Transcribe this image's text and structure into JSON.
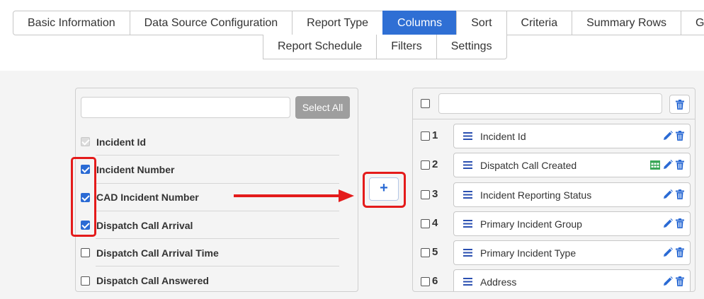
{
  "tabs_row1": [
    {
      "label": "Basic Information",
      "active": false
    },
    {
      "label": "Data Source Configuration",
      "active": false
    },
    {
      "label": "Report Type",
      "active": false
    },
    {
      "label": "Columns",
      "active": true
    },
    {
      "label": "Sort",
      "active": false
    },
    {
      "label": "Criteria",
      "active": false
    },
    {
      "label": "Summary Rows",
      "active": false
    },
    {
      "label": "G",
      "active": false
    }
  ],
  "tabs_row2": [
    {
      "label": "Report Schedule"
    },
    {
      "label": "Filters"
    },
    {
      "label": "Settings"
    }
  ],
  "left_panel": {
    "search_placeholder": "",
    "select_all_label": "Select All",
    "fields": [
      {
        "label": "Incident Id",
        "state": "disabled-checked"
      },
      {
        "label": "Incident Number",
        "state": "checked"
      },
      {
        "label": "CAD Incident Number",
        "state": "checked"
      },
      {
        "label": "Dispatch Call Arrival",
        "state": "checked"
      },
      {
        "label": "Dispatch Call Arrival Time",
        "state": "unchecked"
      },
      {
        "label": "Dispatch Call Answered",
        "state": "unchecked"
      }
    ]
  },
  "add_button": {
    "glyph": "+"
  },
  "right_panel": {
    "search_placeholder": "",
    "columns": [
      {
        "num": "1",
        "label": "Incident Id",
        "has_table_icon": false
      },
      {
        "num": "2",
        "label": "Dispatch Call Created",
        "has_table_icon": true
      },
      {
        "num": "3",
        "label": "Incident Reporting Status",
        "has_table_icon": false
      },
      {
        "num": "4",
        "label": "Primary Incident Group",
        "has_table_icon": false
      },
      {
        "num": "5",
        "label": "Primary Incident Type",
        "has_table_icon": false
      },
      {
        "num": "6",
        "label": "Address",
        "has_table_icon": false
      }
    ]
  },
  "colors": {
    "accent": "#2f6fd4",
    "highlight": "#e41b1b",
    "table_icon": "#3aa757"
  }
}
